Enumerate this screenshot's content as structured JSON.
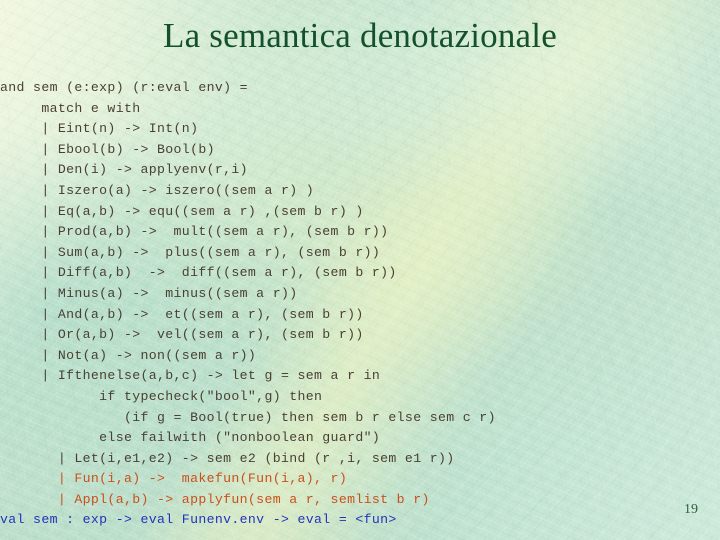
{
  "slide": {
    "title": "La semantica denotazionale",
    "page_number": "19",
    "colors": {
      "title": "#14512b",
      "code_default": "#4a3f33",
      "code_orange": "#c9501e",
      "code_blue": "#2233bb",
      "page_number": "#2c5f3c",
      "background": "#c9e6cd"
    }
  },
  "code": {
    "language": "ocaml",
    "lines": [
      {
        "text": "and sem (e:exp) (r:eval env) =",
        "color": "dark"
      },
      {
        "text": "     match e with",
        "color": "dark"
      },
      {
        "text": "     | Eint(n) -> Int(n)",
        "color": "dark"
      },
      {
        "text": "     | Ebool(b) -> Bool(b)",
        "color": "dark"
      },
      {
        "text": "     | Den(i) -> applyenv(r,i)",
        "color": "dark"
      },
      {
        "text": "     | Iszero(a) -> iszero((sem a r) )",
        "color": "dark"
      },
      {
        "text": "     | Eq(a,b) -> equ((sem a r) ,(sem b r) )",
        "color": "dark"
      },
      {
        "text": "     | Prod(a,b) ->  mult((sem a r), (sem b r))",
        "color": "dark"
      },
      {
        "text": "     | Sum(a,b) ->  plus((sem a r), (sem b r))",
        "color": "dark"
      },
      {
        "text": "     | Diff(a,b)  ->  diff((sem a r), (sem b r))",
        "color": "dark"
      },
      {
        "text": "     | Minus(a) ->  minus((sem a r))",
        "color": "dark"
      },
      {
        "text": "     | And(a,b) ->  et((sem a r), (sem b r))",
        "color": "dark"
      },
      {
        "text": "     | Or(a,b) ->  vel((sem a r), (sem b r))",
        "color": "dark"
      },
      {
        "text": "     | Not(a) -> non((sem a r))",
        "color": "dark"
      },
      {
        "text": "     | Ifthenelse(a,b,c) -> let g = sem a r in",
        "color": "dark"
      },
      {
        "text": "            if typecheck(\"bool\",g) then",
        "color": "dark"
      },
      {
        "text": "               (if g = Bool(true) then sem b r else sem c r)",
        "color": "dark"
      },
      {
        "text": "            else failwith (\"nonboolean guard\")",
        "color": "dark"
      },
      {
        "text": "       | Let(i,e1,e2) -> sem e2 (bind (r ,i, sem e1 r))",
        "color": "dark"
      },
      {
        "text": "       | Fun(i,a) ->  makefun(Fun(i,a), r)",
        "color": "orange"
      },
      {
        "text": "       | Appl(a,b) -> applyfun(sem a r, semlist b r)",
        "color": "orange"
      },
      {
        "text": "val sem : exp -> eval Funenv.env -> eval = <fun>",
        "color": "blue"
      }
    ]
  }
}
